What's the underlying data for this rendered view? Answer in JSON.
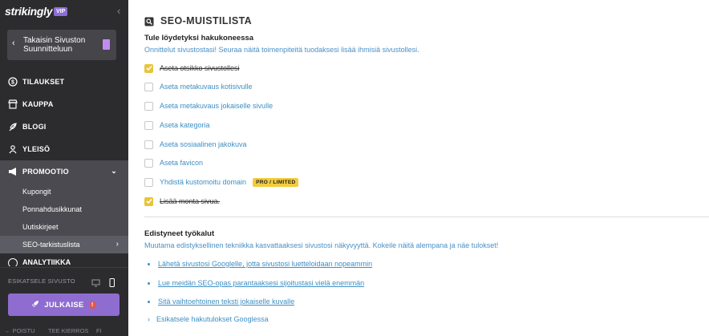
{
  "sidebar": {
    "logo": "strikingly",
    "vip_badge": "VIP",
    "back_label": "Takaisin Sivuston Suunnitteluun",
    "nav": [
      {
        "label": "TILAUKSET",
        "icon": "dollar-circle-icon"
      },
      {
        "label": "KAUPPA",
        "icon": "store-icon"
      },
      {
        "label": "BLOGI",
        "icon": "quill-icon"
      },
      {
        "label": "YLEISÖ",
        "icon": "audience-icon"
      },
      {
        "label": "PROMOOTIO",
        "icon": "megaphone-icon"
      }
    ],
    "sub_items": [
      {
        "label": "Kupongit"
      },
      {
        "label": "Ponnahdusikkunat"
      },
      {
        "label": "Uutiskirjeet"
      },
      {
        "label": "SEO-tarkistuslista"
      }
    ],
    "cut_item": "ANALYTIIKKA",
    "preview_label": "ESIKATSELE SIVUSTO",
    "publish_label": "JULKAISE",
    "footer": {
      "exit": "POISTU",
      "tour": "TEE KIERROS",
      "lang": "FI"
    }
  },
  "main": {
    "title": "SEO-MUISTILISTA",
    "section1": {
      "heading": "Tule löydetyksi hakukoneessa",
      "desc": "Onnittelut sivustostasi! Seuraa näitä toimenpiteitä tuodaksesi lisää ihmisiä sivustollesi.",
      "items": [
        {
          "label": "Aseta otsikko sivustollesi",
          "checked": true
        },
        {
          "label": "Aseta metakuvaus kotisivulle",
          "checked": false
        },
        {
          "label": "Aseta metakuvaus jokaiselle sivulle",
          "checked": false
        },
        {
          "label": "Aseta kategoria",
          "checked": false
        },
        {
          "label": "Aseta sosiaalinen jakokuva",
          "checked": false
        },
        {
          "label": "Aseta favicon",
          "checked": false
        },
        {
          "label": "Yhdistä kustomoitu domain",
          "checked": false,
          "badge": "PRO / LIMITED"
        },
        {
          "label": "Lisää monta sivua.",
          "checked": true
        }
      ]
    },
    "section2": {
      "heading": "Edistyneet työkalut",
      "desc": "Muutama edistyksellinen tekniikka kasvattaaksesi sivustosi näkyvyyttä. Kokeile näitä alempana ja näe tulokset!",
      "links": [
        {
          "label": "Lähetä sivustosi Googlelle, jotta sivustosi luetteloidaan nopeammin"
        },
        {
          "label": "Lue meidän SEO-opas parantaaksesi sijoitustasi vielä enemmän"
        },
        {
          "label": "Sitä vaihtoehtoinen teksti jokaiselle kuvalle"
        }
      ],
      "expand_label": "Esikatsele hakutulokset Googlessa"
    }
  },
  "colors": {
    "sidebar_bg": "#2c2c2f",
    "accent_purple": "#8e6cd0",
    "link_blue": "#3e8fc4",
    "check_yellow": "#e8c43a"
  }
}
